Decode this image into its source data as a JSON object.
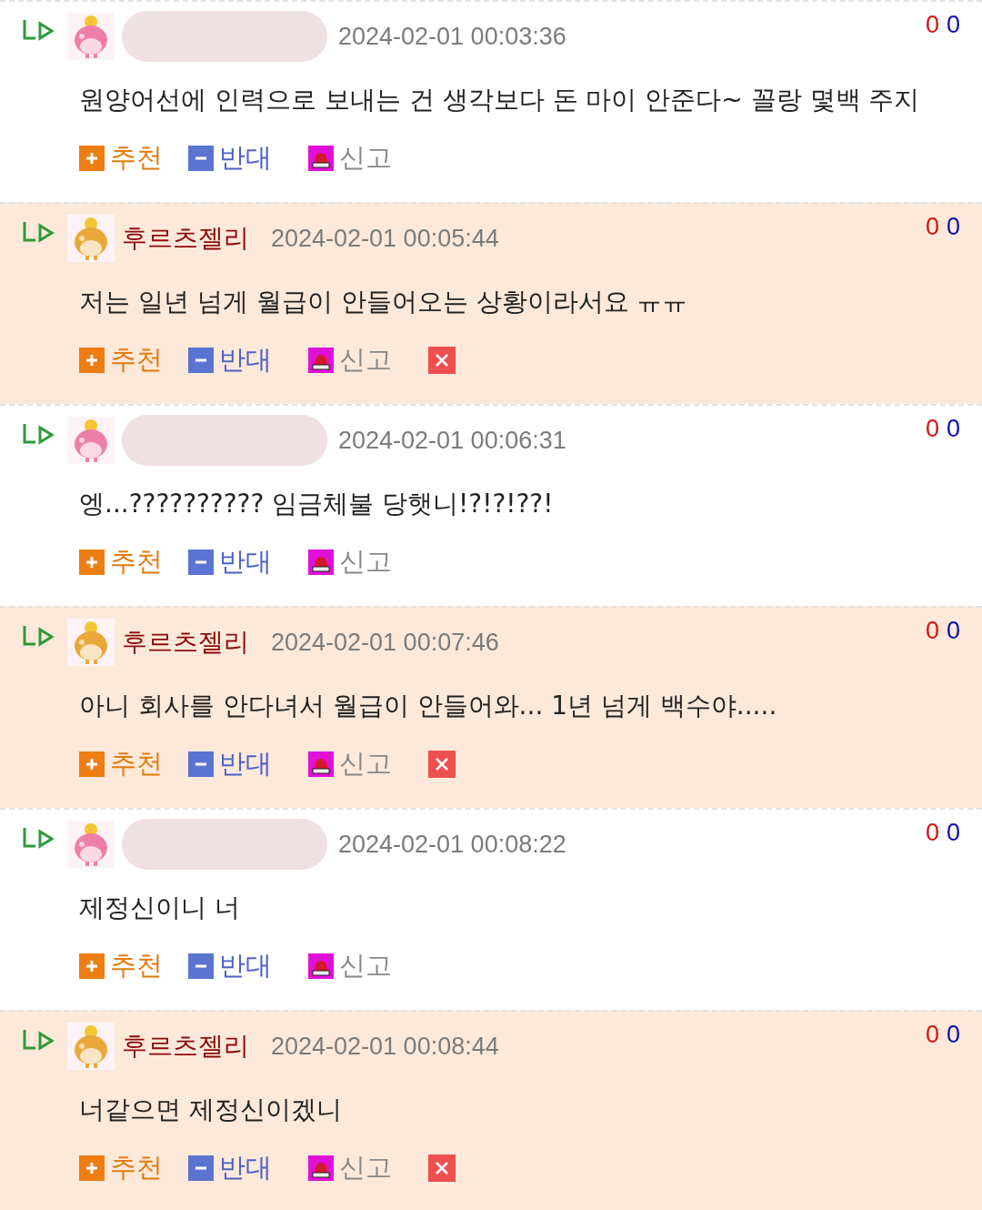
{
  "comments": [
    {
      "name_redacted": true,
      "date": "2024-02-01 00:03:36",
      "likes": "0",
      "dislikes": "0",
      "text": "원양어선에 인력으로 보내는 건 생각보다 돈 마이 안준다~ 꼴랑 몇백 주지",
      "highlighted": false,
      "deletable": false,
      "actions": {
        "up": "추천",
        "down": "반대",
        "report": "신고"
      }
    },
    {
      "name": "후르츠젤리",
      "date": "2024-02-01 00:05:44",
      "likes": "0",
      "dislikes": "0",
      "text": "저는 일년 넘게 월급이 안들어오는 상황이라서요 ㅠㅠ",
      "highlighted": true,
      "deletable": true,
      "actions": {
        "up": "추천",
        "down": "반대",
        "report": "신고"
      }
    },
    {
      "name_redacted": true,
      "date": "2024-02-01 00:06:31",
      "likes": "0",
      "dislikes": "0",
      "text": "엥...?????????? 임금체불 당햇니!?!?!??!",
      "highlighted": false,
      "deletable": false,
      "actions": {
        "up": "추천",
        "down": "반대",
        "report": "신고"
      }
    },
    {
      "name": "후르츠젤리",
      "date": "2024-02-01 00:07:46",
      "likes": "0",
      "dislikes": "0",
      "text": "아니 회사를 안다녀서 월급이 안들어와... 1년 넘게 백수야.....",
      "highlighted": true,
      "deletable": true,
      "actions": {
        "up": "추천",
        "down": "반대",
        "report": "신고"
      }
    },
    {
      "name_redacted": true,
      "date": "2024-02-01 00:08:22",
      "likes": "0",
      "dislikes": "0",
      "text": "제정신이니 너",
      "highlighted": false,
      "deletable": false,
      "actions": {
        "up": "추천",
        "down": "반대",
        "report": "신고"
      }
    },
    {
      "name": "후르츠젤리",
      "date": "2024-02-01 00:08:44",
      "likes": "0",
      "dislikes": "0",
      "text": "너같으면 제정신이겠니",
      "highlighted": true,
      "deletable": true,
      "actions": {
        "up": "추천",
        "down": "반대",
        "report": "신고"
      }
    }
  ]
}
